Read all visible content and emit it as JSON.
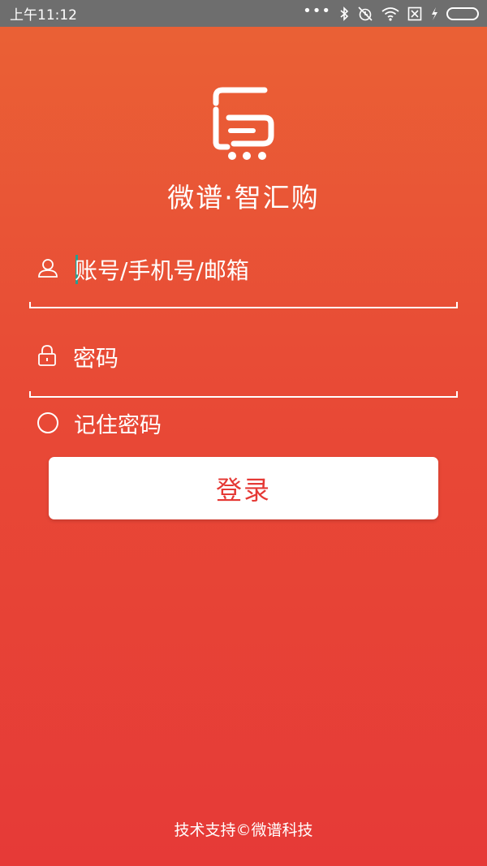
{
  "status_bar": {
    "time": "上午11:12",
    "icons": [
      "more-dots-icon",
      "bluetooth-icon",
      "alarm-off-icon",
      "wifi-icon",
      "sim-off-icon",
      "charging-icon",
      "battery-icon"
    ]
  },
  "brand": {
    "logo_icon": "cart-logo-icon",
    "name": "微谱·智汇购"
  },
  "login_form": {
    "username": {
      "icon": "user-icon",
      "placeholder": "账号/手机号/邮箱",
      "value": ""
    },
    "password": {
      "icon": "lock-icon",
      "placeholder": "密码",
      "value": ""
    },
    "remember": {
      "label": "记住密码",
      "checked": false
    },
    "submit_label": "登录"
  },
  "footer": {
    "text": "技术支持©微谱科技"
  },
  "colors": {
    "background_top": "#ea6235",
    "background_bottom": "#e63a37",
    "button_text": "#e53935",
    "cursor": "#2a9d8f"
  }
}
